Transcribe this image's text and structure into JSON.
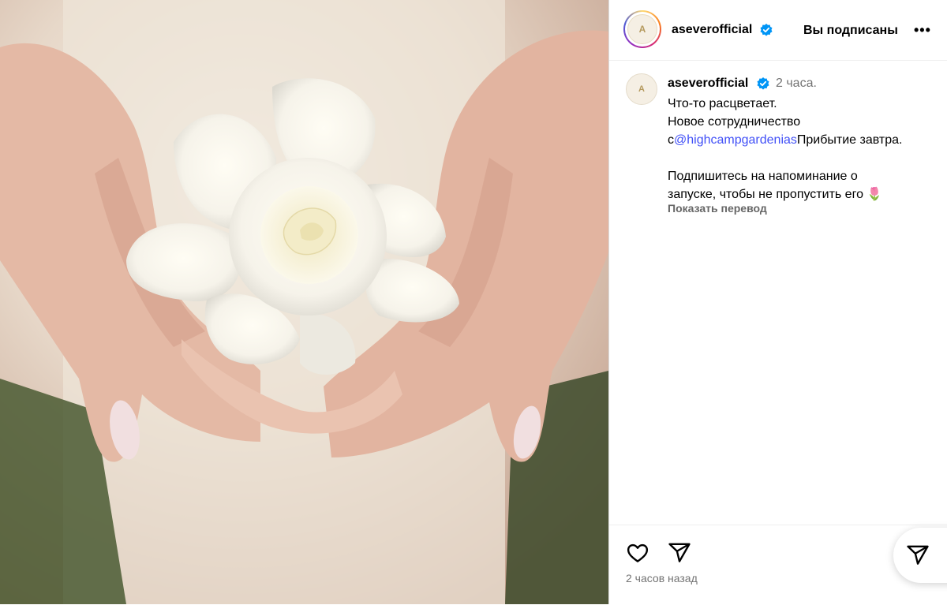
{
  "post": {
    "username": "aseverofficial",
    "follow_status": "Вы подписаны",
    "more_icon": "more-horizontal-icon",
    "avatar_text": "A"
  },
  "caption": {
    "username": "aseverofficial",
    "time": "2 часа.",
    "line1": "Что-то расцветает.",
    "line2": "Новое сотрудничество",
    "line3_prefix": "с",
    "mention": "@highcampgardenias",
    "line3_suffix": "Прибытие завтра.",
    "line4": "Подпишитесь на напоминание о",
    "line5": "запуске, чтобы не пропустить его",
    "emoji": "🌷",
    "translate": "Показать перевод"
  },
  "actions": {
    "like_icon": "heart-icon",
    "share_icon": "send-icon",
    "timestamp": "2 часов назад"
  },
  "colors": {
    "mention": "#4150f7",
    "verified": "#0095f6",
    "secondary_text": "#737373"
  }
}
